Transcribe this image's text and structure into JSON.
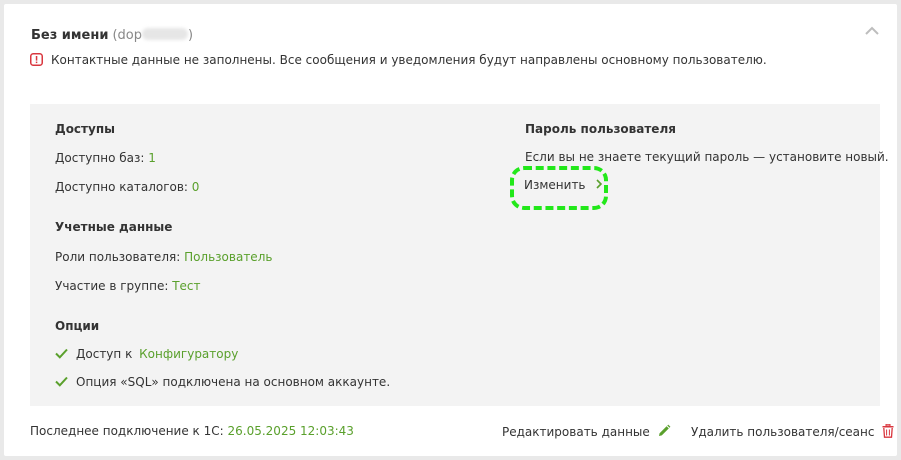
{
  "header": {
    "name": "Без имени",
    "login_prefix": "(dop",
    "login_suffix": ")"
  },
  "warning": {
    "text": "Контактные данные не заполнены. Все сообщения и уведомления будут направлены основному пользователю."
  },
  "access": {
    "title": "Доступы",
    "bases_label": "Доступно баз: ",
    "bases_value": "1",
    "catalogs_label": "Доступно каталогов: ",
    "catalogs_value": "0"
  },
  "account": {
    "title": "Учетные данные",
    "roles_label": "Роли пользователя: ",
    "roles_value": "Пользователь",
    "group_label": "Участие в группе: ",
    "group_value": "Тест"
  },
  "options": {
    "title": "Опции",
    "items": [
      {
        "prefix": "Доступ к ",
        "link": "Конфигуратору",
        "suffix": ""
      },
      {
        "prefix": "Опция «SQL» подключена на основном аккаунте.",
        "link": "",
        "suffix": ""
      }
    ]
  },
  "password": {
    "title": "Пароль пользователя",
    "hint": "Если вы не знаете текущий пароль — установите новый.",
    "change_label": "Изменить"
  },
  "footer": {
    "last_connection_label": "Последнее подключение к 1С: ",
    "last_connection_value": "26.05.2025 12:03:43",
    "edit_label": "Редактировать данные",
    "delete_label": "Удалить пользователя/сеанс"
  },
  "colors": {
    "accent": "#5aa02c",
    "warning": "#d9363e",
    "highlight": "#22e81a",
    "panel_bg": "#f3f3f3"
  },
  "icons": {
    "collapse": "chevron-up-icon",
    "warning": "warning-icon",
    "check": "check-icon",
    "chevron": "chevron-right-icon",
    "edit": "pencil-icon",
    "delete": "trash-icon"
  }
}
